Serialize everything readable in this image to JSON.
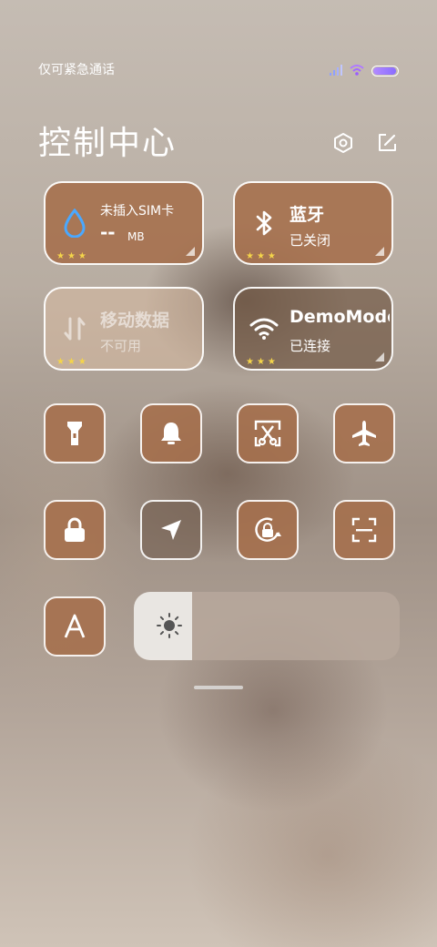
{
  "status_bar": {
    "text": "仅可紧急通话",
    "battery_level": 0.95,
    "colors": {
      "battery": "#9a7cff"
    }
  },
  "header": {
    "title": "控制中心",
    "icons": [
      "settings-hexagon-icon",
      "edit-icon"
    ]
  },
  "tiles": {
    "sim": {
      "label": "未插入SIM卡",
      "value": "--",
      "unit": "MB",
      "icon": "water-drop-icon",
      "stars": "★★★"
    },
    "bluetooth": {
      "label": "蓝牙",
      "status": "已关闭",
      "icon": "bluetooth-icon",
      "stars": "★★★"
    },
    "mobile_data": {
      "label": "移动数据",
      "status": "不可用",
      "icon": "data-arrows-icon",
      "stars": "★★★"
    },
    "wifi": {
      "label": "DemoMode",
      "status": "已连接",
      "icon": "wifi-icon",
      "stars": "★★★"
    }
  },
  "quick_toggles": [
    {
      "name": "flashlight",
      "icon": "flashlight-icon",
      "active": true
    },
    {
      "name": "silent",
      "icon": "bell-icon",
      "active": true
    },
    {
      "name": "screenshot",
      "icon": "scissors-icon",
      "active": true
    },
    {
      "name": "airplane",
      "icon": "airplane-icon",
      "active": true
    },
    {
      "name": "lock",
      "icon": "lock-icon",
      "active": true
    },
    {
      "name": "location",
      "icon": "location-arrow-icon",
      "active": false
    },
    {
      "name": "auto-rotate",
      "icon": "rotate-lock-icon",
      "active": true
    },
    {
      "name": "scan",
      "icon": "scan-icon",
      "active": true
    },
    {
      "name": "auto-brightness",
      "icon": "letter-a-icon",
      "active": true
    }
  ],
  "brightness": {
    "level": 0.22,
    "icon": "sun-icon"
  },
  "colors": {
    "accent": "#a56e4b",
    "star": "#f4d44a",
    "wifi_signal": "#a56bff",
    "cell_signal": "#8fa0ff"
  }
}
